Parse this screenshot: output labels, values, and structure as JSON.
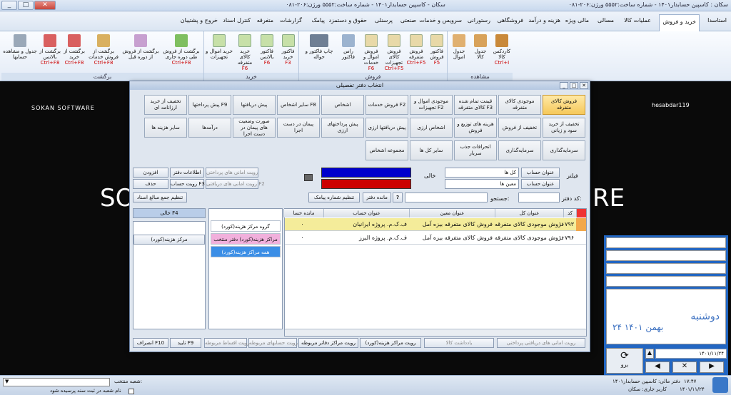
{
  "window": {
    "title": "سکان - کاسپین حسابدار۱۴۰۱ - شماره ساخت:۵۵۵۲ ورژن:۲۰۶-۰۸۱",
    "app_title": "سکان : کاسپین حسابدار۱۴۰۱ - شماره ساخت:۵۵۵۲ ورژن:۲۰۶-۰۸۱"
  },
  "menu": [
    "استاسدا",
    "خرید و فروش",
    "عملیات کالا",
    "مسالی",
    "مالی ویژه",
    "هزینه و درآمد",
    "فروشگاهی",
    "رستورانی",
    "سرویس و خدمات",
    "صنعتی",
    "پرسنلی",
    "حقوق و دستمزد",
    "پیامک",
    "گزارشات",
    "متفرقه",
    "کنترل اسناد",
    "خروج و پشتیبان"
  ],
  "ribbon": {
    "groups": [
      "مشاهده",
      "فروش",
      "خرید",
      "برگشت"
    ],
    "buttons": [
      {
        "label": "کاردکس کالا",
        "shortcut": "Ctrl+I"
      },
      {
        "label": "جدول کالا",
        "shortcut": ""
      },
      {
        "label": "جدول اموال",
        "shortcut": ""
      },
      {
        "label": "فاکتور فروش",
        "shortcut": "F5"
      },
      {
        "label": "فروش متفرقه",
        "shortcut": "Ctrl+F5"
      },
      {
        "label": "فروش کالای تجهیزات",
        "shortcut": "Ctrl+F5"
      },
      {
        "label": "فروش اموال و خدمات",
        "shortcut": "F6"
      },
      {
        "label": "راس فاکتور",
        "shortcut": ""
      },
      {
        "label": "چاپ فاکتور و حواله",
        "shortcut": ""
      },
      {
        "label": "فاکتور خرید",
        "shortcut": "F3"
      },
      {
        "label": "فاکتور بالانس",
        "shortcut": "F6"
      },
      {
        "label": "خرید کالای متفرقه",
        "shortcut": "F6"
      },
      {
        "label": "خرید اموال و تجهیزات",
        "shortcut": ""
      },
      {
        "label": "برگشت از فروش طی دوره جاری",
        "shortcut": "Ctrl+F8"
      },
      {
        "label": "برگشت از فروش از دوره قبل",
        "shortcut": ""
      },
      {
        "label": "برگشت از فروش خدمات",
        "shortcut": "Ctrl+F8"
      },
      {
        "label": "برگشت از خرید",
        "shortcut": "Ctrl+F8"
      },
      {
        "label": "برگشت از بالانس",
        "shortcut": "Ctrl+F8"
      },
      {
        "label": "جدول و مشاهده حسابها",
        "shortcut": ""
      }
    ]
  },
  "background": {
    "left_brand": "SOKAN SOFTWARE",
    "right_user": "hesabdar119",
    "big_left": "SO",
    "big_right": "RE"
  },
  "dialog": {
    "title": "انتخاب دفتر تفصیلی",
    "tiles_row1": [
      "فروش کالای متفرقه",
      "موجودی کالای متفرقه",
      "قیمت تمام شده کالای متفرقه F3",
      "موجودی اموال و تجهیزات F2",
      "فروش خدمات F2",
      "اشخاص",
      "سایر اشخاص F8",
      "پیش دریافتها",
      "پیش پرداختها F9",
      "تخفیف از خرید ارزانامه ای"
    ],
    "tiles_row2": [
      "تخفیف از خرید سود و زیانی",
      "تخفیف از فروش",
      "هزینه های توزیع و فروش",
      "اشخاص ارزی",
      "پیش دریافتها ارزی",
      "پیش پرداختهای ارزی",
      "پیمان در دست اجرا",
      "صورت وضعیت های پیمان در دست اجرا",
      "درآمدها",
      "سایر هزینه ها"
    ],
    "tiles_row3": [
      "سرمایه‌گذاری",
      "سرمایه‌گذاری",
      "انحرافات جذب سربار",
      "سایر کل ها",
      "مجموعه اشخاص"
    ],
    "side_buttons": {
      "add": "افزودن",
      "daftar_info": "اطلاعات دفتر",
      "delete": "حذف",
      "view_ht": "رویت حساب F3",
      "view_amani_pardakht": "رویت امانی های پرداختی",
      "view_amani_daryaft": "رویت امانی های دریافتی F2",
      "total": "تنظیم جمع مبالغ اسناد"
    },
    "filter": {
      "label": "فیلتر",
      "kol_btn": "عنوان حساب",
      "moin_btn": "عنوان حساب",
      "kol_val": "کل ها",
      "moin_val": "معین ها",
      "empty": "خالی"
    },
    "search": {
      "daftar_label": "کد دفتر:",
      "search_label": "جستجو:",
      "mande": "مانده دفتر",
      "sms": "تنظیم شماره پیامک",
      "help": "?"
    },
    "grid": {
      "headers": [
        "کد",
        "عنوان کل",
        "عنوان معین",
        "عنوان حساب",
        "مانده حسا"
      ],
      "rows": [
        [
          "۱۰۷۹۳",
          "فروش موجودی کالای متفرقه",
          "فروش کالای متفرقه بیزه آمل",
          "ف.ک.م. پروژه ایرانیان",
          "۰"
        ],
        [
          "۱۰۷۹۶",
          "فروش موجودی کالای متفرقه",
          "فروش کالای متفرقه بیزه آمل",
          "ف.ک.م. پروژه البرز",
          "۰"
        ]
      ]
    },
    "left": {
      "empty_f4": "خالی F4",
      "cost_center": "مرکز هزینه(کورد)",
      "group_cost": "گروه مرکز هزینه(کورد)",
      "cost_selected": "مراکز هزینه(کورد) دفتر منتخب",
      "all_cost": "همه مراکز هزینه(کورد)"
    },
    "bottom": [
      "رویت امانی های دریافتی پرداختی",
      "یادداشت کالا",
      "رویت مراکز هزینه(کورد)",
      "رویت مراکز دفاتر مربوطه",
      "رویت حسابهای مربوطه",
      "رویت اقساط مربوطه",
      "تایید F9",
      "انصراف F10"
    ]
  },
  "rpanel": {
    "date": "۱۴۰۱/۱۱/۲۴",
    "calendar_day": "دوشنبه",
    "calendar_date": "۲۴ بهمن ۱۴۰۱",
    "go": "برو"
  },
  "status": {
    "branch_label": "شعبه منتخب:",
    "branch_check": "نام شعبه در ثبت سند پرسیده شود",
    "fiscal": "دفتر مالی: کاسپین حسابدار۱۴۰۱",
    "user": "کاربر جاری: سکان",
    "time": "۱۷:۴۷",
    "date": "۱۴۰۱/۱۱/۲۴"
  }
}
